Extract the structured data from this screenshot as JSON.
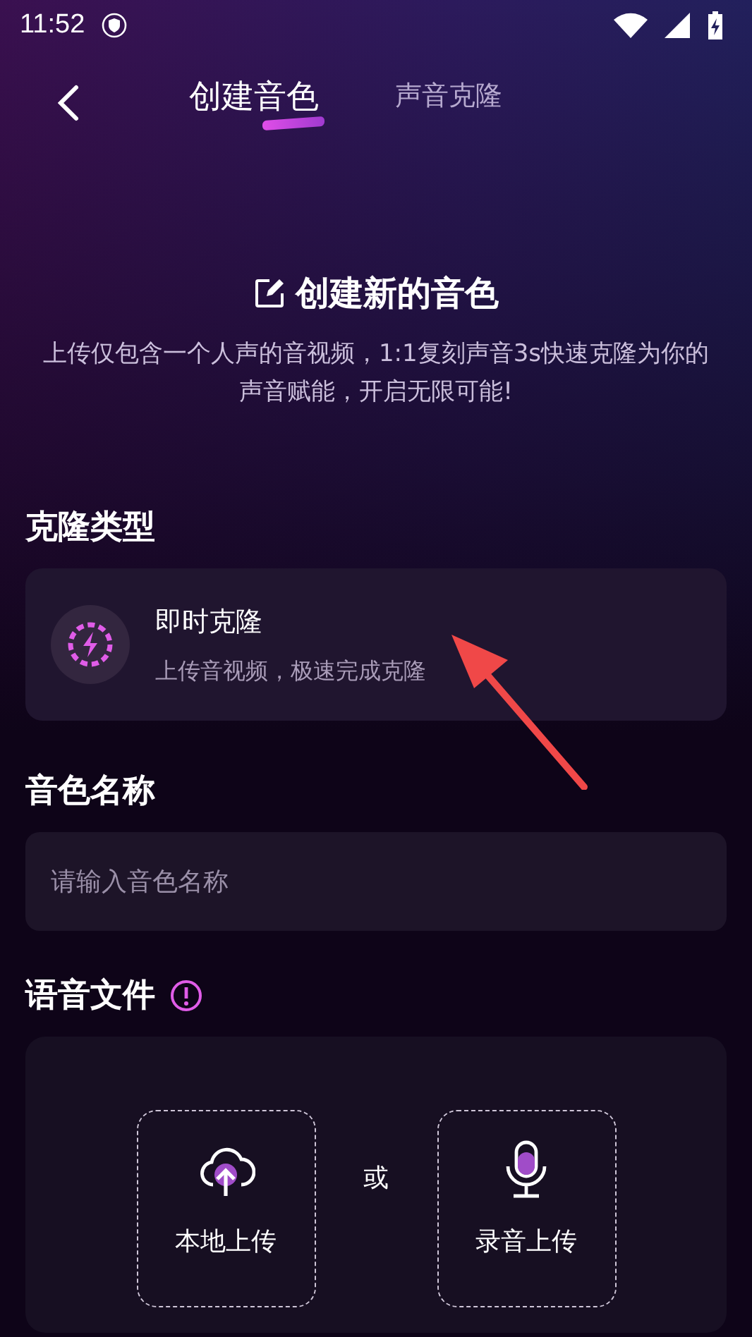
{
  "status_bar": {
    "time": "11:52"
  },
  "nav": {
    "tabs": [
      {
        "label": "创建音色",
        "selected": true
      },
      {
        "label": "声音克隆",
        "selected": false
      }
    ]
  },
  "intro": {
    "title": "创建新的音色",
    "description": "上传仅包含一个人声的音视频，1:1复刻声音3s快速克隆为你的声音赋能，开启无限可能!"
  },
  "clone_type": {
    "heading": "克隆类型",
    "option": {
      "title": "即时克隆",
      "subtitle": "上传音视频，极速完成克隆"
    }
  },
  "voice_name": {
    "heading": "音色名称",
    "placeholder": "请输入音色名称"
  },
  "voice_file": {
    "heading": "语音文件",
    "options": [
      {
        "kind": "upload",
        "label": "本地上传"
      },
      {
        "kind": "record",
        "label": "录音上传"
      }
    ],
    "separator": "或"
  }
}
